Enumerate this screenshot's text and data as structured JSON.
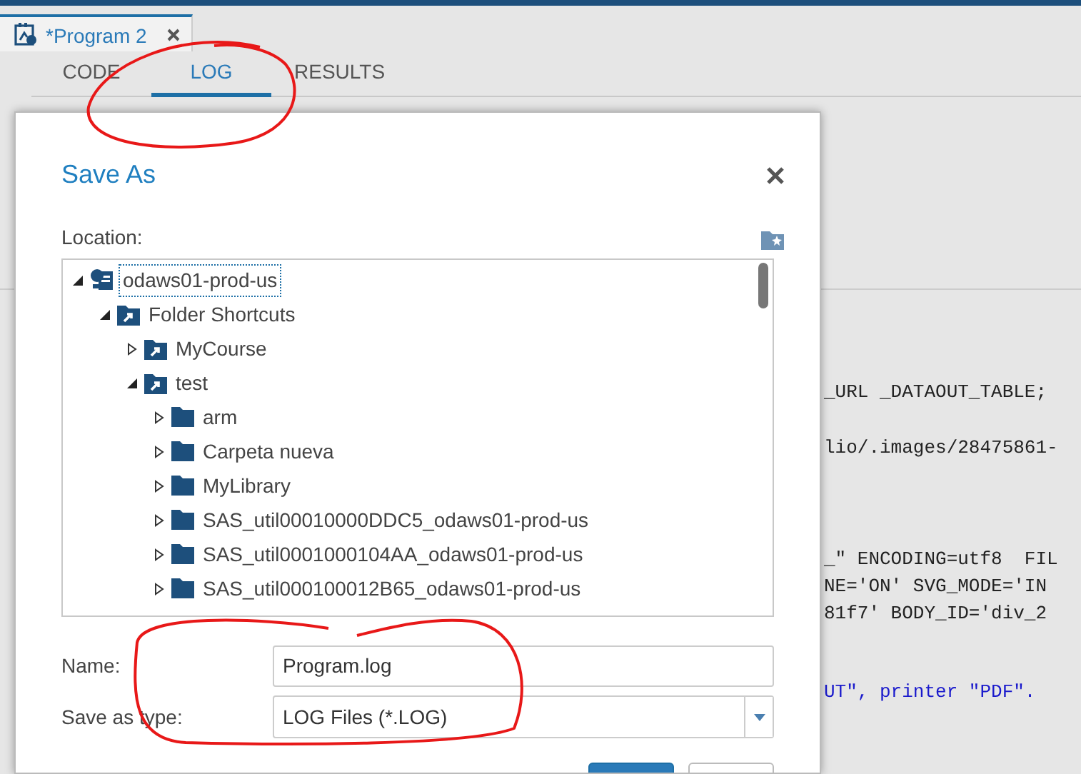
{
  "document_tab": {
    "title": "*Program 2"
  },
  "view_tabs": [
    {
      "label": "CODE",
      "selected": false
    },
    {
      "label": "LOG",
      "selected": true
    },
    {
      "label": "RESULTS",
      "selected": false
    }
  ],
  "log_lines": [
    {
      "text": "_URL _DATAOUT_TABLE;",
      "kind": "code"
    },
    {
      "text": "lio/.images/28475861-",
      "kind": "code"
    },
    {
      "text": "_\" ENCODING=utf8  FIL",
      "kind": "code"
    },
    {
      "text": "NE='ON' SVG_MODE='IN",
      "kind": "code"
    },
    {
      "text": "81f7' BODY_ID='div_2",
      "kind": "code"
    },
    {
      "text": "UT\", printer \"PDF\".",
      "kind": "note"
    }
  ],
  "dialog": {
    "title": "Save As",
    "location_label": "Location:",
    "tree": [
      {
        "label": "odaws01-prod-us",
        "kind": "server",
        "expanded": true,
        "selected": true,
        "children": [
          {
            "label": "Folder Shortcuts",
            "kind": "shortcut",
            "expanded": true,
            "selected": false,
            "children": [
              {
                "label": "MyCourse",
                "kind": "shortcut",
                "expanded": false,
                "selected": false
              },
              {
                "label": "test",
                "kind": "shortcut",
                "expanded": true,
                "selected": false,
                "children": [
                  {
                    "label": "arm",
                    "kind": "folder",
                    "expanded": false,
                    "selected": false
                  },
                  {
                    "label": "Carpeta nueva",
                    "kind": "folder",
                    "expanded": false,
                    "selected": false
                  },
                  {
                    "label": "MyLibrary",
                    "kind": "folder",
                    "expanded": false,
                    "selected": false
                  },
                  {
                    "label": "SAS_util00010000DDC5_odaws01-prod-us",
                    "kind": "folder",
                    "expanded": false,
                    "selected": false
                  },
                  {
                    "label": "SAS_util0001000104AA_odaws01-prod-us",
                    "kind": "folder",
                    "expanded": false,
                    "selected": false
                  },
                  {
                    "label": "SAS_util000100012B65_odaws01-prod-us",
                    "kind": "folder",
                    "expanded": false,
                    "selected": false
                  }
                ]
              }
            ]
          }
        ]
      }
    ],
    "name_label": "Name:",
    "name_value": "Program.log",
    "type_label": "Save as type:",
    "type_value": "LOG Files (*.LOG)",
    "footer_buttons": [
      {
        "kind": "primary"
      },
      {
        "kind": "secondary"
      }
    ]
  }
}
